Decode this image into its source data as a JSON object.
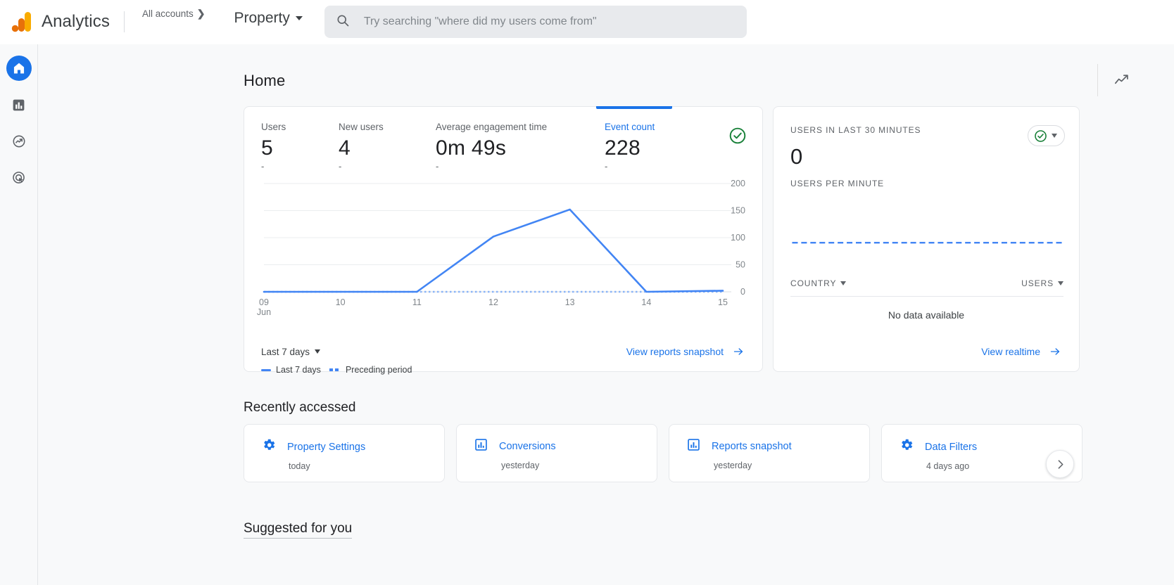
{
  "header": {
    "brand": "Analytics",
    "accounts_label": "All accounts",
    "accounts_chevron": "chevron-right-icon",
    "property_label": "Property",
    "search_placeholder": "Try searching \"where did my users come from\"",
    "search_value": "",
    "search_icon": "search-icon"
  },
  "sidebar": {
    "items": [
      {
        "name": "home",
        "icon": "home-icon",
        "active": true
      },
      {
        "name": "reports",
        "icon": "bar-chart-icon",
        "active": false
      },
      {
        "name": "explore",
        "icon": "explore-trend-icon",
        "active": false
      },
      {
        "name": "advertising",
        "icon": "advertising-target-icon",
        "active": false
      }
    ]
  },
  "page": {
    "title": "Home",
    "insights_icon": "insights-trend-icon"
  },
  "overview_card": {
    "metrics": [
      {
        "label": "Users",
        "value": "5",
        "delta": "-",
        "selected": false
      },
      {
        "label": "New users",
        "value": "4",
        "delta": "-",
        "selected": false
      },
      {
        "label": "Average engagement time",
        "value": "0m 49s",
        "delta": "-",
        "selected": false
      },
      {
        "label": "Event count",
        "value": "228",
        "delta": "-",
        "selected": true
      }
    ],
    "badge_icon": "check-circle-icon",
    "date_range": "Last 7 days",
    "view_link": "View reports snapshot",
    "view_link_icon": "arrow-right-icon"
  },
  "chart_data": {
    "type": "line",
    "title": "Event count",
    "xlabel": "",
    "ylabel": "",
    "x": [
      "09",
      "10",
      "11",
      "12",
      "13",
      "14",
      "15"
    ],
    "x_month_label": "Jun",
    "ylim": [
      0,
      200
    ],
    "yticks": [
      0,
      50,
      100,
      150,
      200
    ],
    "grid": true,
    "legend_position": "bottom-left",
    "series": [
      {
        "name": "Last 7 days",
        "style": "solid",
        "color": "#4285f4",
        "values": [
          0,
          0,
          0,
          102,
          152,
          0,
          2
        ]
      },
      {
        "name": "Preceding period",
        "style": "dashed",
        "color": "#8ab4f8",
        "values": [
          0,
          0,
          0,
          0,
          0,
          0,
          0
        ]
      }
    ]
  },
  "realtime_card": {
    "users_label": "USERS IN LAST 30 MINUTES",
    "users_value": "0",
    "per_minute_label": "USERS PER MINUTE",
    "badge_icon": "check-circle-icon",
    "table": {
      "columns": [
        "COUNTRY",
        "USERS"
      ],
      "rows": [],
      "empty_text": "No data available"
    },
    "view_link": "View realtime",
    "view_link_icon": "arrow-right-icon",
    "sparkline": {
      "minutes": 30,
      "values": [
        0,
        0,
        0,
        0,
        0,
        0,
        0,
        0,
        0,
        0,
        0,
        0,
        0,
        0,
        0,
        0,
        0,
        0,
        0,
        0,
        0,
        0,
        0,
        0,
        0,
        0,
        0,
        0,
        0,
        0
      ]
    }
  },
  "recent": {
    "title": "Recently accessed",
    "next_icon": "chevron-right-icon",
    "cards": [
      {
        "name": "Property Settings",
        "when": "today",
        "icon": "gear-icon"
      },
      {
        "name": "Conversions",
        "when": "yesterday",
        "icon": "bar-chart-icon"
      },
      {
        "name": "Reports snapshot",
        "when": "yesterday",
        "icon": "bar-chart-icon"
      },
      {
        "name": "Data Filters",
        "when": "4 days ago",
        "icon": "gear-icon"
      }
    ]
  },
  "suggested": {
    "title": "Suggested for you"
  },
  "colors": {
    "brand_blue": "#1a73e8",
    "chart_blue": "#4285f4",
    "green": "#188038",
    "logo_orange": "#f9ab00",
    "logo_amber": "#e8710a"
  }
}
